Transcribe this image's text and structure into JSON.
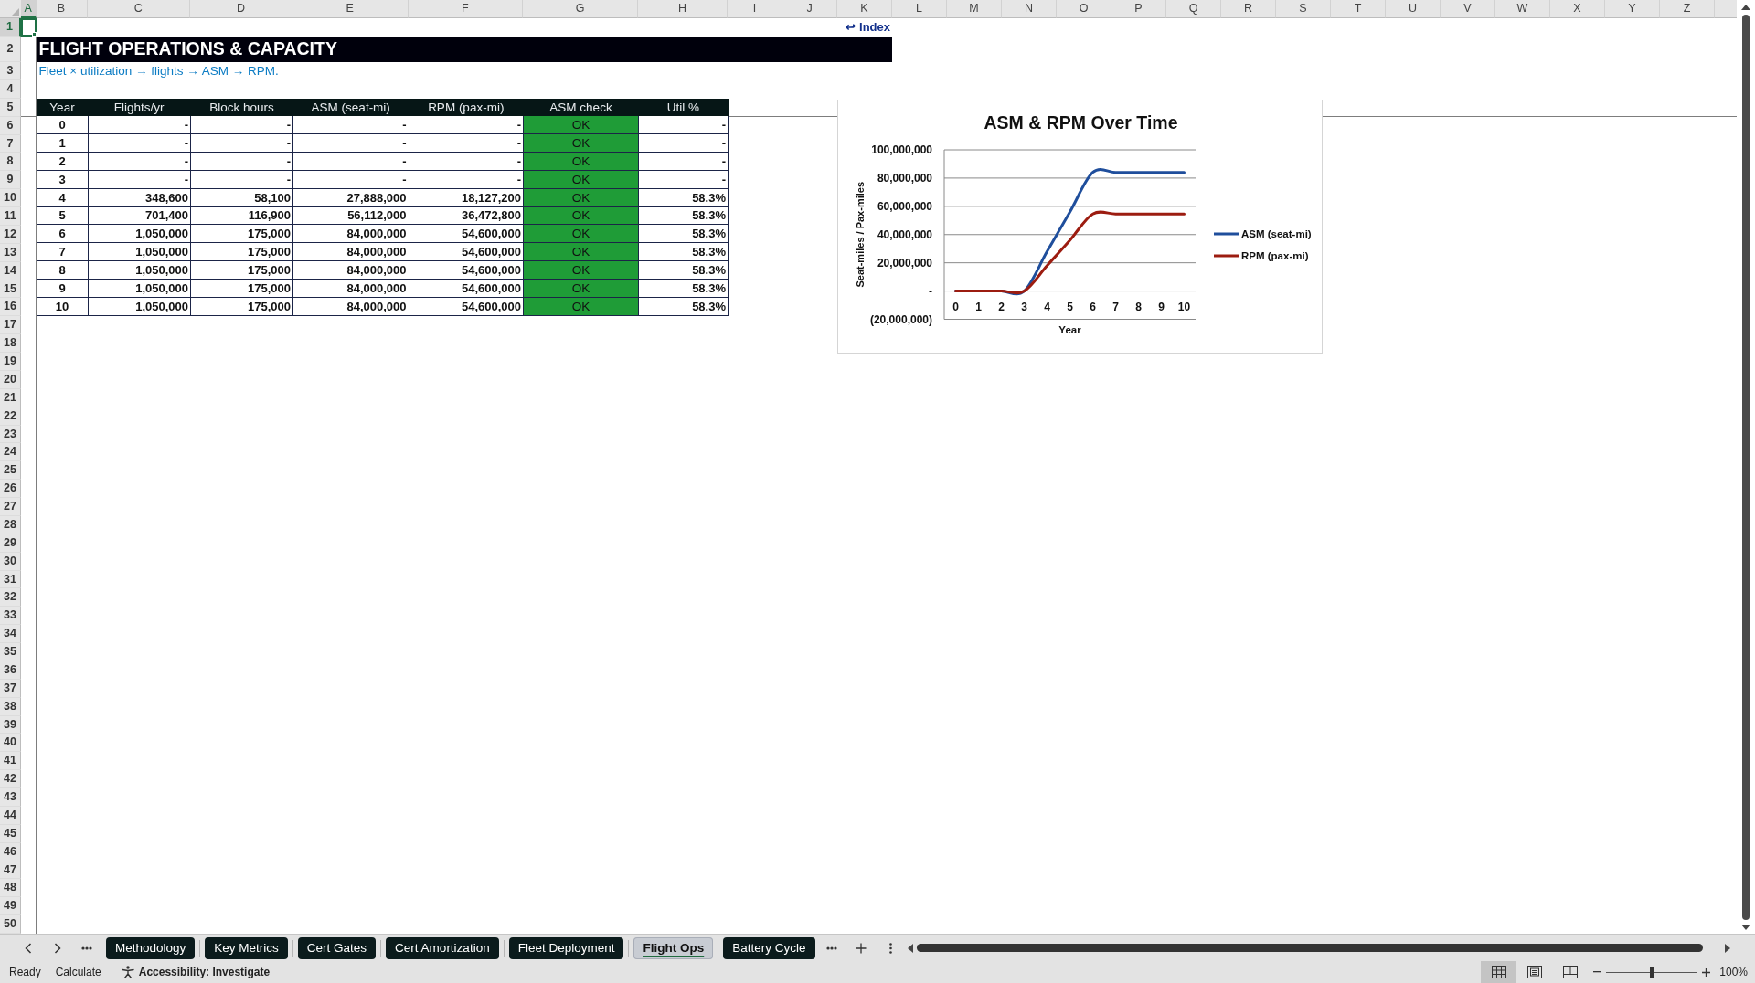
{
  "column_headers": [
    {
      "label": "A",
      "selected": true
    },
    {
      "label": "B",
      "selected": false
    },
    {
      "label": "C",
      "selected": false
    },
    {
      "label": "D",
      "selected": false
    },
    {
      "label": "E",
      "selected": false
    },
    {
      "label": "F",
      "selected": false
    },
    {
      "label": "G",
      "selected": false
    },
    {
      "label": "H",
      "selected": false
    },
    {
      "label": "I",
      "selected": false
    },
    {
      "label": "J",
      "selected": false
    },
    {
      "label": "K",
      "selected": false
    },
    {
      "label": "L",
      "selected": false
    },
    {
      "label": "M",
      "selected": false
    },
    {
      "label": "N",
      "selected": false
    },
    {
      "label": "O",
      "selected": false
    },
    {
      "label": "P",
      "selected": false
    },
    {
      "label": "Q",
      "selected": false
    },
    {
      "label": "R",
      "selected": false
    },
    {
      "label": "S",
      "selected": false
    },
    {
      "label": "T",
      "selected": false
    },
    {
      "label": "U",
      "selected": false
    },
    {
      "label": "V",
      "selected": false
    },
    {
      "label": "W",
      "selected": false
    },
    {
      "label": "X",
      "selected": false
    },
    {
      "label": "Y",
      "selected": false
    },
    {
      "label": "Z",
      "selected": false
    }
  ],
  "row_headers": [
    {
      "label": "1",
      "selected": true
    },
    {
      "label": "2",
      "selected": false
    },
    {
      "label": "3",
      "selected": false
    },
    {
      "label": "4",
      "selected": false
    },
    {
      "label": "5",
      "selected": false
    },
    {
      "label": "6",
      "selected": false
    },
    {
      "label": "7",
      "selected": false
    },
    {
      "label": "8",
      "selected": false
    },
    {
      "label": "9",
      "selected": false
    },
    {
      "label": "10",
      "selected": false
    },
    {
      "label": "11",
      "selected": false
    },
    {
      "label": "12",
      "selected": false
    },
    {
      "label": "13",
      "selected": false
    },
    {
      "label": "14",
      "selected": false
    },
    {
      "label": "15",
      "selected": false
    },
    {
      "label": "16",
      "selected": false
    },
    {
      "label": "17",
      "selected": false
    },
    {
      "label": "18",
      "selected": false
    },
    {
      "label": "19",
      "selected": false
    },
    {
      "label": "20",
      "selected": false
    },
    {
      "label": "21",
      "selected": false
    },
    {
      "label": "22",
      "selected": false
    },
    {
      "label": "23",
      "selected": false
    },
    {
      "label": "24",
      "selected": false
    },
    {
      "label": "25",
      "selected": false
    },
    {
      "label": "26",
      "selected": false
    },
    {
      "label": "27",
      "selected": false
    },
    {
      "label": "28",
      "selected": false
    },
    {
      "label": "29",
      "selected": false
    },
    {
      "label": "30",
      "selected": false
    },
    {
      "label": "31",
      "selected": false
    },
    {
      "label": "32",
      "selected": false
    },
    {
      "label": "33",
      "selected": false
    },
    {
      "label": "34",
      "selected": false
    },
    {
      "label": "35",
      "selected": false
    },
    {
      "label": "36",
      "selected": false
    },
    {
      "label": "37",
      "selected": false
    },
    {
      "label": "38",
      "selected": false
    },
    {
      "label": "39",
      "selected": false
    },
    {
      "label": "40",
      "selected": false
    },
    {
      "label": "41",
      "selected": false
    },
    {
      "label": "42",
      "selected": false
    },
    {
      "label": "43",
      "selected": false
    },
    {
      "label": "44",
      "selected": false
    },
    {
      "label": "45",
      "selected": false
    },
    {
      "label": "46",
      "selected": false
    },
    {
      "label": "47",
      "selected": false
    },
    {
      "label": "48",
      "selected": false
    },
    {
      "label": "49",
      "selected": false
    },
    {
      "label": "50",
      "selected": false
    }
  ],
  "index_link": "↩ Index",
  "title": "FLIGHT OPERATIONS & CAPACITY",
  "subtitle": "Fleet × utilization → flights → ASM → RPM.",
  "table": {
    "columns": [
      {
        "label": "Year",
        "kind": "key"
      },
      {
        "label": "Flights/yr",
        "kind": "number"
      },
      {
        "label": "Block hours",
        "kind": "number"
      },
      {
        "label": "ASM (seat-mi)",
        "kind": "number"
      },
      {
        "label": "RPM (pax-mi)",
        "kind": "number"
      },
      {
        "label": "ASM check",
        "kind": "check"
      },
      {
        "label": "Util %",
        "kind": "number"
      }
    ],
    "rows": [
      {
        "cells": [
          "0",
          "-",
          "-",
          "-",
          "-",
          "OK",
          "-"
        ],
        "check_passed": true
      },
      {
        "cells": [
          "1",
          "-",
          "-",
          "-",
          "-",
          "OK",
          "-"
        ],
        "check_passed": true
      },
      {
        "cells": [
          "2",
          "-",
          "-",
          "-",
          "-",
          "OK",
          "-"
        ],
        "check_passed": true
      },
      {
        "cells": [
          "3",
          "-",
          "-",
          "-",
          "-",
          "OK",
          "-"
        ],
        "check_passed": true
      },
      {
        "cells": [
          "4",
          "348,600",
          "58,100",
          "27,888,000",
          "18,127,200",
          "OK",
          "58.3%"
        ],
        "check_passed": true
      },
      {
        "cells": [
          "5",
          "701,400",
          "116,900",
          "56,112,000",
          "36,472,800",
          "OK",
          "58.3%"
        ],
        "check_passed": true
      },
      {
        "cells": [
          "6",
          "1,050,000",
          "175,000",
          "84,000,000",
          "54,600,000",
          "OK",
          "58.3%"
        ],
        "check_passed": true
      },
      {
        "cells": [
          "7",
          "1,050,000",
          "175,000",
          "84,000,000",
          "54,600,000",
          "OK",
          "58.3%"
        ],
        "check_passed": true
      },
      {
        "cells": [
          "8",
          "1,050,000",
          "175,000",
          "84,000,000",
          "54,600,000",
          "OK",
          "58.3%"
        ],
        "check_passed": true
      },
      {
        "cells": [
          "9",
          "1,050,000",
          "175,000",
          "84,000,000",
          "54,600,000",
          "OK",
          "58.3%"
        ],
        "check_passed": true
      },
      {
        "cells": [
          "10",
          "1,050,000",
          "175,000",
          "84,000,000",
          "54,600,000",
          "OK",
          "58.3%"
        ],
        "check_passed": true
      }
    ]
  },
  "chart": {
    "chart_data": {
      "type": "line",
      "title": "ASM & RPM Over Time",
      "xlabel": "Year",
      "ylabel": "Seat-miles / Pax-miles",
      "categories": [
        "0",
        "1",
        "2",
        "3",
        "4",
        "5",
        "6",
        "7",
        "8",
        "9",
        "10"
      ],
      "series": [
        {
          "name": "ASM (seat-mi)",
          "color": "#1f4e9c",
          "values": [
            0,
            0,
            0,
            0,
            28000000,
            56000000,
            84000000,
            84000000,
            84000000,
            84000000,
            84000000
          ]
        },
        {
          "name": "RPM (pax-mi)",
          "color": "#9c1c10",
          "values": [
            0,
            0,
            0,
            0,
            18000000,
            36000000,
            54600000,
            54600000,
            54600000,
            54600000,
            54600000
          ]
        }
      ],
      "ylim": [
        -20000000,
        100000000
      ],
      "yticks": [
        {
          "value": 100000000,
          "label": "100,000,000"
        },
        {
          "value": 80000000,
          "label": "80,000,000"
        },
        {
          "value": 60000000,
          "label": "60,000,000"
        },
        {
          "value": 40000000,
          "label": "40,000,000"
        },
        {
          "value": 20000000,
          "label": "20,000,000"
        },
        {
          "value": 0,
          "label": "-"
        },
        {
          "value": -20000000,
          "label": "(20,000,000)"
        }
      ],
      "grid": true,
      "legend": true
    }
  },
  "sheet_tabs": [
    {
      "label": "Methodology",
      "selected": false
    },
    {
      "label": "Key Metrics",
      "selected": false
    },
    {
      "label": "Cert Gates",
      "selected": false
    },
    {
      "label": "Cert Amortization",
      "selected": false
    },
    {
      "label": "Fleet Deployment",
      "selected": false
    },
    {
      "label": "Flight Ops",
      "selected": true
    },
    {
      "label": "Battery Cycle",
      "selected": false
    }
  ],
  "status_bar": {
    "items": [
      "Ready",
      "Calculate"
    ],
    "accessibility": "Accessibility: Investigate",
    "view_buttons": [
      {
        "kind": "normal",
        "selected": true
      },
      {
        "kind": "page-layout",
        "selected": false
      },
      {
        "kind": "page-break",
        "selected": false
      }
    ],
    "zoom": {
      "level": 0.5,
      "reading": "100%"
    }
  }
}
